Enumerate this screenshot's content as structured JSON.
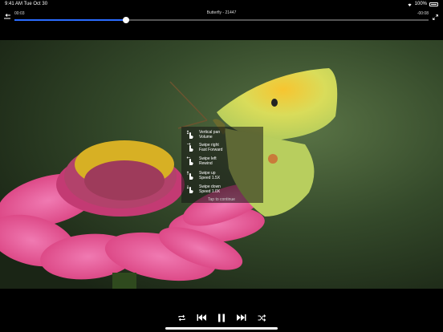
{
  "status_bar": {
    "time": "9:41 AM",
    "date": "Tue Oct 30",
    "battery": "100%"
  },
  "player": {
    "title": "Butterfly - 21447",
    "elapsed": "00:03",
    "remaining": "-00:08",
    "progress": 0.27
  },
  "gesture_help": {
    "items": [
      {
        "line1": "Vertical pan",
        "line2": "Volume"
      },
      {
        "line1": "Swipe right",
        "line2": "Fast Forward"
      },
      {
        "line1": "Swipe left",
        "line2": "Rewind"
      },
      {
        "line1": "Swipe up",
        "line2": "Speed 1.5X"
      },
      {
        "line1": "Swipe down",
        "line2": "Speed 1.0X"
      }
    ],
    "tap_to_continue": "Tap to continue"
  },
  "icons": {
    "back": "back-icon",
    "fullscreen": "exit-fullscreen-icon",
    "repeat": "repeat-icon",
    "previous": "skip-previous-icon",
    "pause": "pause-icon",
    "next": "skip-next-icon",
    "shuffle": "shuffle-icon"
  },
  "colors": {
    "accent": "#2b6cff"
  }
}
